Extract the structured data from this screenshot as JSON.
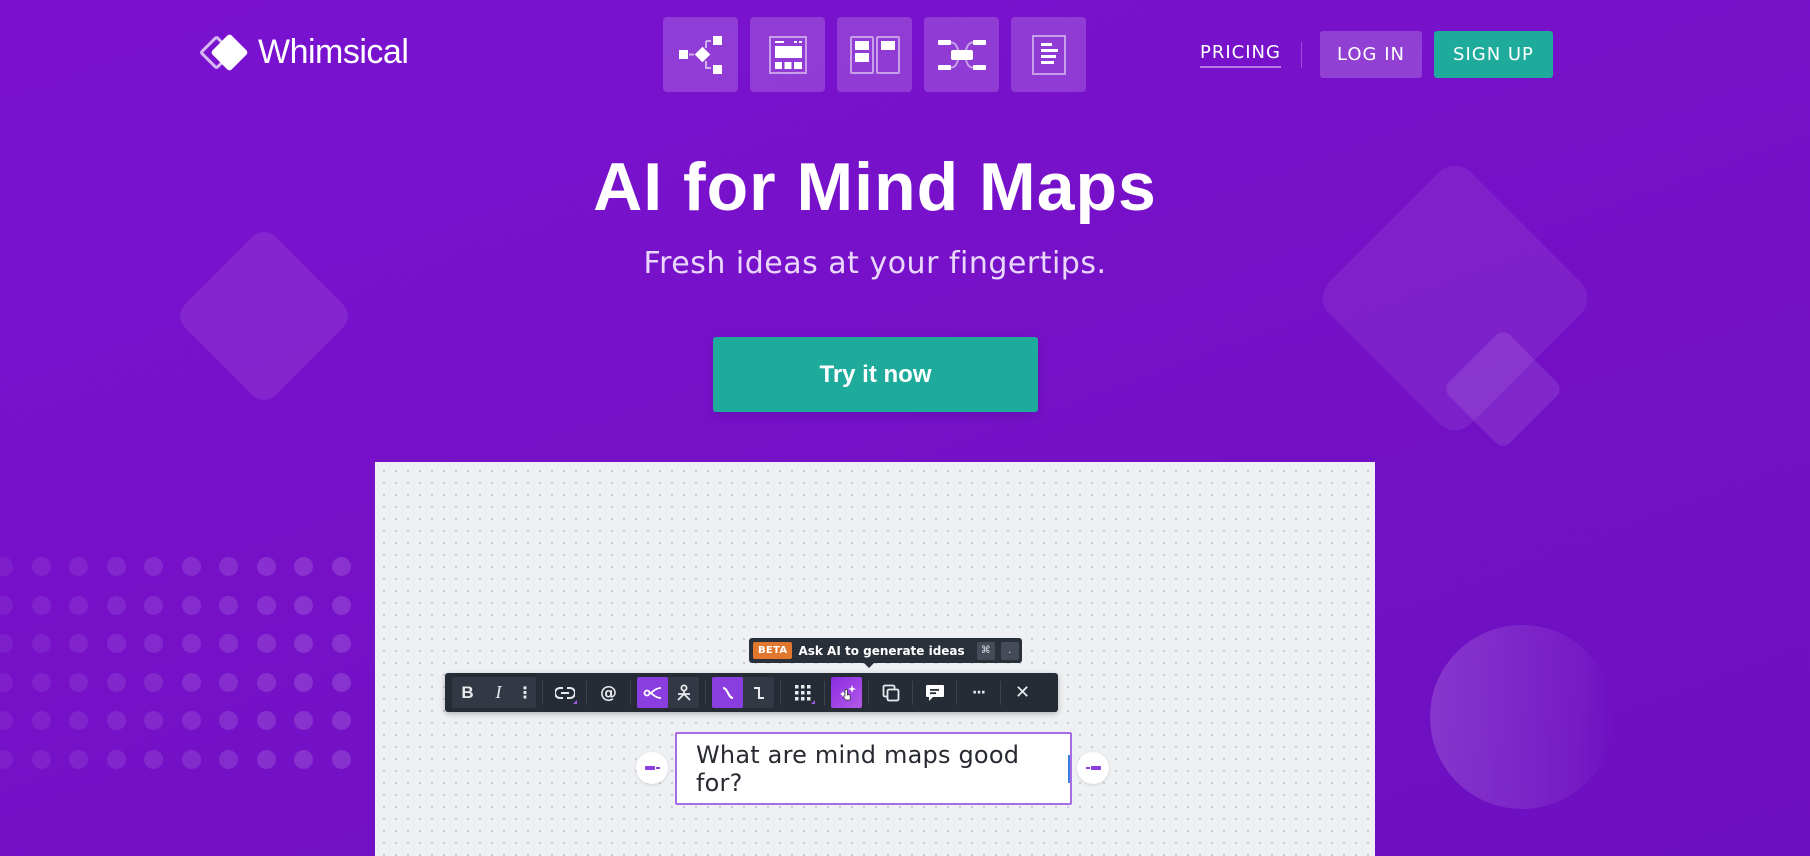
{
  "brand": {
    "name": "Whimsical",
    "accent_purple": "#7a12d0",
    "accent_teal": "#1eab9b"
  },
  "header": {
    "products": [
      {
        "name": "flowcharts",
        "icon": "flowchart-icon"
      },
      {
        "name": "wireframes",
        "icon": "wireframe-icon"
      },
      {
        "name": "boards",
        "icon": "board-icon"
      },
      {
        "name": "mind-maps",
        "icon": "mindmap-icon"
      },
      {
        "name": "docs",
        "icon": "doc-icon"
      }
    ],
    "pricing_label": "PRICING",
    "login_label": "LOG IN",
    "signup_label": "SIGN UP"
  },
  "hero": {
    "title": "AI for Mind Maps",
    "subtitle": "Fresh ideas at your fingertips.",
    "cta_label": "Try it now"
  },
  "preview": {
    "tooltip": {
      "badge": "BETA",
      "text": "Ask AI to generate ideas",
      "shortcut_keys": [
        "⌘",
        "."
      ]
    },
    "toolbar": {
      "buttons": [
        {
          "name": "bold",
          "glyph": "B"
        },
        {
          "name": "italic",
          "glyph": "I"
        },
        {
          "name": "text-more",
          "glyph": "⋮"
        },
        {
          "name": "link",
          "icon": "link-icon"
        },
        {
          "name": "mention",
          "glyph": "@"
        },
        {
          "name": "layout-branches",
          "icon": "branch-icon",
          "active": true
        },
        {
          "name": "layout-tree",
          "icon": "tree-icon"
        },
        {
          "name": "curved-connector",
          "icon": "curve-icon",
          "active": true
        },
        {
          "name": "elbow-connector",
          "icon": "elbow-icon"
        },
        {
          "name": "color-grid",
          "icon": "grid-icon"
        },
        {
          "name": "ai-generate",
          "icon": "sparkle-icon",
          "active": true
        },
        {
          "name": "duplicate",
          "icon": "copy-icon"
        },
        {
          "name": "comment",
          "icon": "comment-icon"
        },
        {
          "name": "more",
          "glyph": "···"
        },
        {
          "name": "close",
          "glyph": "✕"
        }
      ]
    },
    "node_text": "What are mind maps good for?"
  }
}
